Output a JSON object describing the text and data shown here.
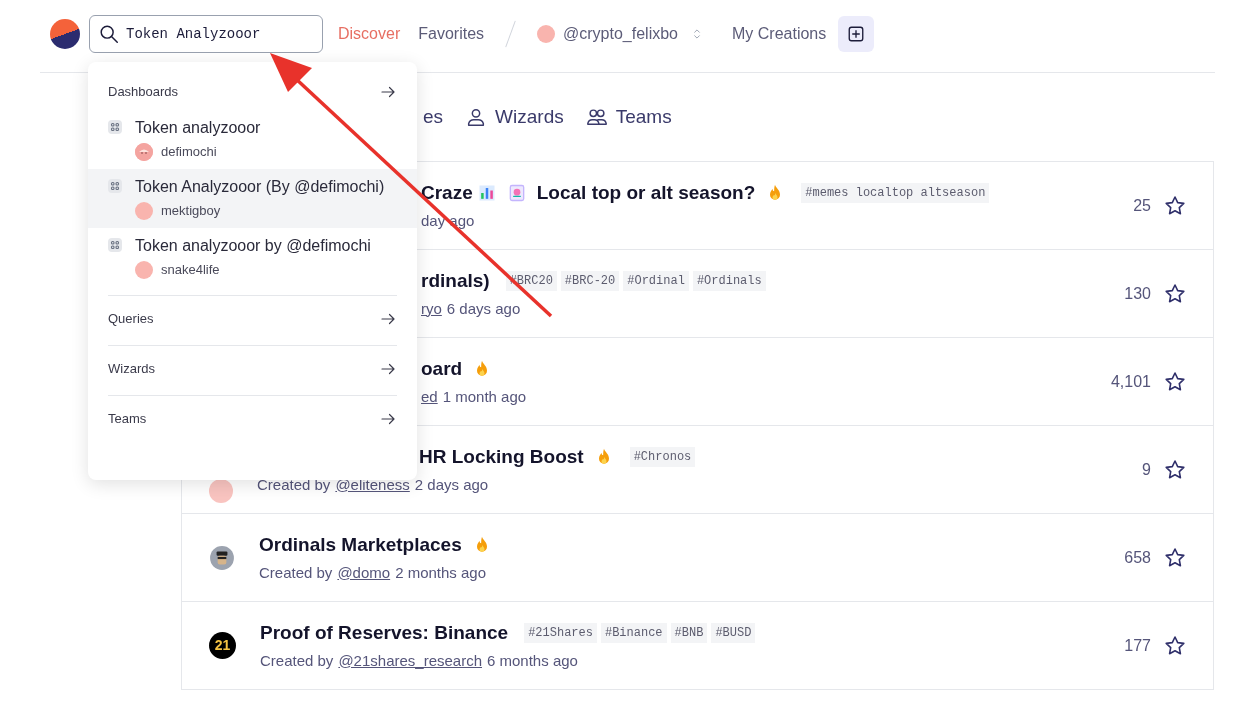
{
  "header": {
    "search": {
      "value": "Token Analyzooor"
    },
    "nav": [
      {
        "label": "Discover",
        "selected": true
      },
      {
        "label": "Favorites",
        "selected": false
      }
    ],
    "account": {
      "name": "@crypto_felixbo",
      "color": "#f9b4ae"
    },
    "my_creations": "My Creations"
  },
  "tabs": [
    {
      "label": "es",
      "kind": "covered"
    },
    {
      "label": "Wizards",
      "kind": "person"
    },
    {
      "label": "Teams",
      "kind": "group"
    }
  ],
  "rows": [
    {
      "title": [
        {
          "kind": "text",
          "text": "Craze"
        },
        {
          "kind": "chart"
        },
        {
          "kind": "joker"
        },
        {
          "kind": "text",
          "text": "Local top or alt season?"
        },
        {
          "kind": "fire"
        }
      ],
      "tags": [
        "#memes localtop altseason"
      ],
      "created": "",
      "author": "",
      "ago": "day ago",
      "count": "25",
      "kind": "covered"
    },
    {
      "title": [
        {
          "kind": "text",
          "text": "rdinals)"
        }
      ],
      "tags": [
        "#BRC20",
        "#BRC-20",
        "#Ordinal",
        "#Ordinals"
      ],
      "created": "",
      "author": "ryo",
      "ago": "6 days ago",
      "count": "130",
      "kind": "covered"
    },
    {
      "title": [
        {
          "kind": "text",
          "text": "oard"
        },
        {
          "kind": "fire"
        }
      ],
      "tags": [],
      "created": "",
      "author": "ed",
      "ago": "1 month ago",
      "count": "4,101",
      "kind": "covered"
    },
    {
      "title": [
        {
          "kind": "text",
          "text": "HR Locking Boost"
        },
        {
          "kind": "fire"
        }
      ],
      "tags": [
        "#Chronos"
      ],
      "created": "Created by",
      "author": "@eliteness",
      "ago": "2 days ago",
      "count": "9",
      "kind": "title_covered"
    },
    {
      "title": [
        {
          "kind": "text",
          "text": "Ordinals Marketplaces"
        },
        {
          "kind": "fire"
        }
      ],
      "tags": [],
      "created": "Created by",
      "author": "@domo",
      "ago": "2 months ago",
      "count": "658",
      "kind": "person"
    },
    {
      "title": [
        {
          "kind": "text",
          "text": "Proof of Reserves: Binance"
        }
      ],
      "tags": [
        "#21Shares",
        "#Binance",
        "#BNB",
        "#BUSD"
      ],
      "created": "Created by",
      "author": "@21shares_research",
      "ago": "6 months ago",
      "count": "177",
      "kind": "logo",
      "avatar_text": "21"
    }
  ],
  "dropdown": {
    "sections": [
      {
        "label": "Dashboards",
        "items": [
          {
            "title": "Token analyzooor",
            "author": "defimochi",
            "selected": false,
            "kind": "face"
          },
          {
            "title": "Token Analyzooor (By @defimochi)",
            "author": "mektigboy",
            "selected": true,
            "kind": "plain"
          },
          {
            "title": "Token analyzooor by @defimochi",
            "author": "snake4life",
            "selected": false,
            "kind": "plain"
          }
        ]
      },
      {
        "label": "Queries"
      },
      {
        "label": "Wizards"
      },
      {
        "label": "Teams"
      }
    ]
  }
}
